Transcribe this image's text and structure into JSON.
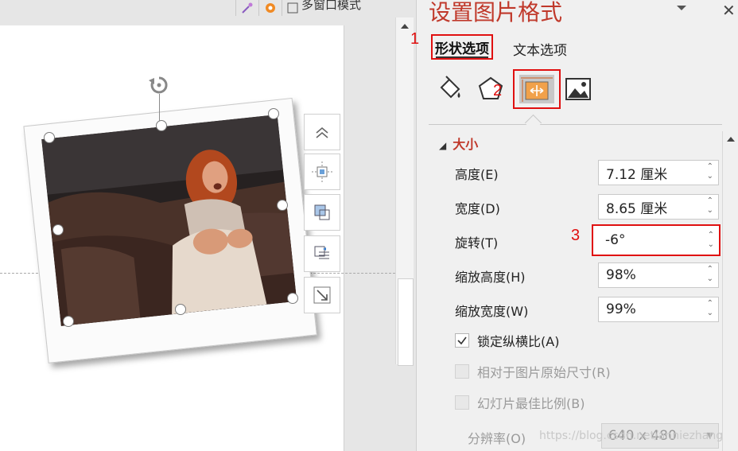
{
  "toolbar": {
    "multi_window_label": "多窗口模式"
  },
  "pane": {
    "title": "设置图片格式",
    "tabs": [
      {
        "label": "形状选项"
      },
      {
        "label": "文本选项"
      }
    ],
    "section_title": "大小",
    "fields": {
      "height": {
        "label": "高度(E)",
        "value": "7.12 厘米"
      },
      "width": {
        "label": "宽度(D)",
        "value": "8.65 厘米"
      },
      "rotation": {
        "label": "旋转(T)",
        "value": "-6°"
      },
      "scale_height": {
        "label": "缩放高度(H)",
        "value": "98%"
      },
      "scale_width": {
        "label": "缩放宽度(W)",
        "value": "99%"
      }
    },
    "checkboxes": {
      "lock_aspect": {
        "label": "锁定纵横比(A)",
        "checked": true
      },
      "relative_original": {
        "label": "相对于图片原始尺寸(R)",
        "checked": false
      },
      "best_scale": {
        "label": "幻灯片最佳比例(B)",
        "checked": false
      }
    },
    "resolution": {
      "label": "分辨率(O)",
      "value": "640 x 480"
    }
  },
  "annotations": {
    "n1": "1",
    "n2": "2",
    "n3": "3"
  },
  "watermark": "https://blog.csdn.net/anniezhang",
  "colors": {
    "accent": "#c0392b",
    "highlight": "#e01010"
  }
}
